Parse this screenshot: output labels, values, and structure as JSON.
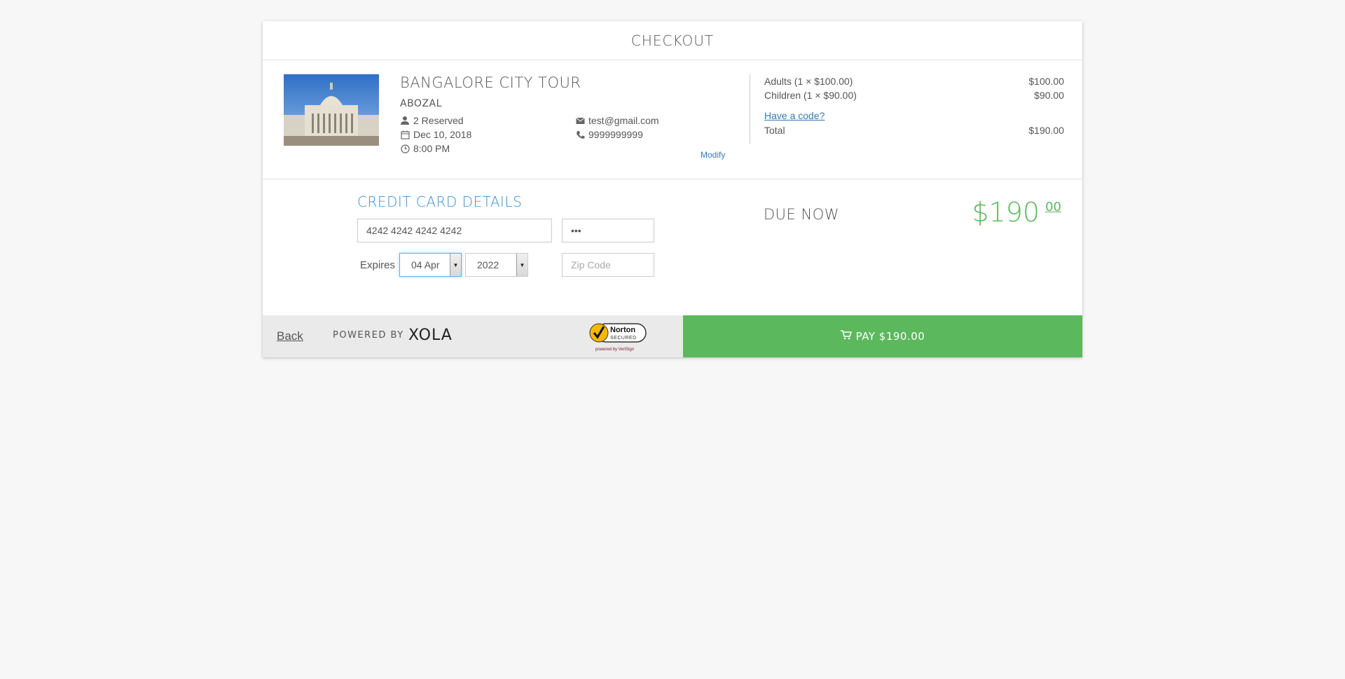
{
  "header": {
    "title": "CHECKOUT"
  },
  "tour": {
    "title": "BANGALORE CITY TOUR",
    "seller": "ABOZAL",
    "reserved": "2 Reserved",
    "date": "Dec 10, 2018",
    "time": "8:00 PM",
    "email": "test@gmail.com",
    "phone": "9999999999",
    "modify_label": "Modify"
  },
  "pricing": {
    "adults_label": "Adults (1 × $100.00)",
    "adults_amount": "$100.00",
    "children_label": "Children (1 × $90.00)",
    "children_amount": "$90.00",
    "code_link": "Have a code?",
    "total_label": "Total",
    "total_amount": "$190.00"
  },
  "payment": {
    "section_title": "CREDIT CARD DETAILS",
    "card_number": "4242 4242 4242 4242",
    "cvv": "•••",
    "expires_label": "Expires",
    "exp_month": "04 Apr",
    "exp_year": "2022",
    "zip_placeholder": "Zip Code",
    "due_label": "DUE NOW",
    "due_whole": "$190",
    "due_cents": "00"
  },
  "footer": {
    "back_label": "Back",
    "powered_by": "POWERED BY",
    "brand": "XOLA",
    "norton_name": "Norton",
    "norton_secured": "SECURED",
    "norton_powered": "powered by VeriSign",
    "pay_label": "PAY $190.00"
  },
  "colors": {
    "accent_blue": "#3d8fd1",
    "link_blue": "#337ab7",
    "pay_green": "#5cb85c"
  },
  "icons": [
    "user-icon",
    "calendar-icon",
    "clock-icon",
    "envelope-icon",
    "phone-icon",
    "cart-icon"
  ]
}
